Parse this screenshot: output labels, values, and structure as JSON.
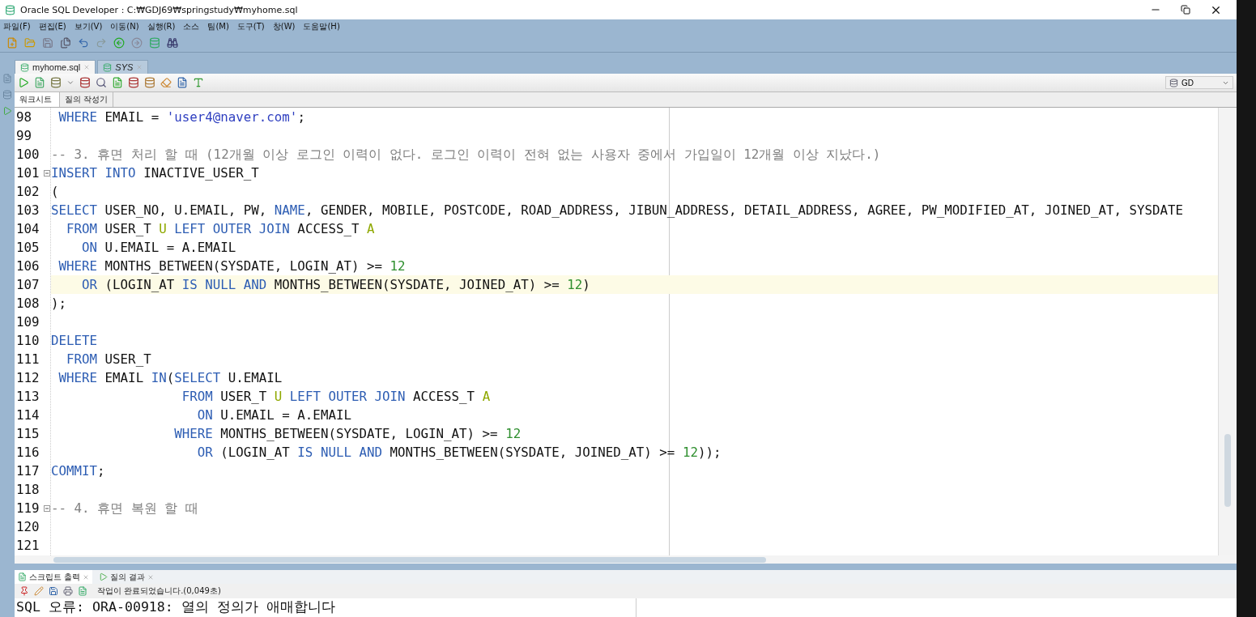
{
  "window": {
    "title": "Oracle SQL Developer : C:₩GDJ69₩springstudy₩myhome.sql"
  },
  "menu": [
    "파일(F)",
    "편집(E)",
    "보기(V)",
    "이동(N)",
    "실행(R)",
    "소스",
    "팀(M)",
    "도구(T)",
    "창(W)",
    "도움말(H)"
  ],
  "editor_tabs": [
    {
      "label": "myhome.sql",
      "selected": true
    },
    {
      "label": "SYS",
      "selected": false
    }
  ],
  "connection": "GD",
  "sub_tabs": [
    {
      "label": "워크시트",
      "selected": true
    },
    {
      "label": "질의 작성기",
      "selected": false
    }
  ],
  "code_lines": [
    {
      "number": "98",
      "fold": false,
      "current": false,
      "tokens": [
        {
          "kind": "keyword",
          "text": " WHERE"
        },
        {
          "kind": "plain",
          "text": " EMAIL = "
        },
        {
          "kind": "string",
          "text": "'user4@naver.com'"
        },
        {
          "kind": "plain",
          "text": ";"
        }
      ]
    },
    {
      "number": "99",
      "fold": false,
      "current": false
    },
    {
      "number": "100",
      "fold": false,
      "current": false,
      "tokens": [
        {
          "kind": "comment",
          "text": "-- 3. 휴면 처리 할 때 (12개월 이상 로그인 이력이 없다. 로그인 이력이 전혀 없는 사용자 중에서 가입일이 12개월 이상 지났다.)"
        }
      ]
    },
    {
      "number": "101",
      "fold": true,
      "current": false,
      "tokens": [
        {
          "kind": "keyword",
          "text": "INSERT INTO"
        },
        {
          "kind": "plain",
          "text": " INACTIVE_USER_T"
        }
      ]
    },
    {
      "number": "102",
      "fold": false,
      "current": false,
      "tokens": [
        {
          "kind": "plain",
          "text": "("
        }
      ]
    },
    {
      "number": "103",
      "fold": false,
      "current": false,
      "tokens": [
        {
          "kind": "keyword",
          "text": "SELECT"
        },
        {
          "kind": "plain",
          "text": " USER_NO, U.EMAIL, PW, "
        },
        {
          "kind": "keyword",
          "text": "NAME"
        },
        {
          "kind": "plain",
          "text": ", GENDER, MOBILE, POSTCODE, ROAD_ADDRESS, JIBUN_ADDRESS, DETAIL_ADDRESS, AGREE, PW_MODIFIED_AT, JOINED_AT, SYSDATE"
        }
      ]
    },
    {
      "number": "104",
      "fold": false,
      "current": false,
      "tokens": [
        {
          "kind": "keyword",
          "text": "  FROM"
        },
        {
          "kind": "plain",
          "text": " USER_T"
        },
        {
          "kind": "alias",
          "text": " U"
        },
        {
          "kind": "keyword",
          "text": " LEFT OUTER JOIN"
        },
        {
          "kind": "plain",
          "text": " ACCESS_T"
        },
        {
          "kind": "alias",
          "text": " A"
        }
      ]
    },
    {
      "number": "105",
      "fold": false,
      "current": false,
      "tokens": [
        {
          "kind": "keyword",
          "text": "    ON"
        },
        {
          "kind": "plain",
          "text": " U.EMAIL = A.EMAIL"
        }
      ]
    },
    {
      "number": "106",
      "fold": false,
      "current": false,
      "tokens": [
        {
          "kind": "keyword",
          "text": " WHERE"
        },
        {
          "kind": "plain",
          "text": " MONTHS_BETWEEN(SYSDATE, LOGIN_AT) >= "
        },
        {
          "kind": "number",
          "text": "12"
        }
      ]
    },
    {
      "number": "107",
      "fold": false,
      "current": true,
      "tokens": [
        {
          "kind": "keyword",
          "text": "    OR"
        },
        {
          "kind": "plain",
          "text": " (LOGIN_AT"
        },
        {
          "kind": "keyword",
          "text": " IS NULL AND"
        },
        {
          "kind": "plain",
          "text": " MONTHS_BETWEEN(SYSDATE, JOINED_AT) >= "
        },
        {
          "kind": "number",
          "text": "12"
        },
        {
          "kind": "plain",
          "text": ")"
        }
      ]
    },
    {
      "number": "108",
      "fold": false,
      "current": false,
      "tokens": [
        {
          "kind": "plain",
          "text": ");"
        }
      ]
    },
    {
      "number": "109",
      "fold": false,
      "current": false
    },
    {
      "number": "110",
      "fold": false,
      "current": false,
      "tokens": [
        {
          "kind": "keyword",
          "text": "DELETE"
        }
      ]
    },
    {
      "number": "111",
      "fold": false,
      "current": false,
      "tokens": [
        {
          "kind": "keyword",
          "text": "  FROM"
        },
        {
          "kind": "plain",
          "text": " USER_T"
        }
      ]
    },
    {
      "number": "112",
      "fold": false,
      "current": false,
      "tokens": [
        {
          "kind": "keyword",
          "text": " WHERE"
        },
        {
          "kind": "plain",
          "text": " EMAIL"
        },
        {
          "kind": "keyword",
          "text": " IN"
        },
        {
          "kind": "plain",
          "text": "("
        },
        {
          "kind": "keyword",
          "text": "SELECT"
        },
        {
          "kind": "plain",
          "text": " U.EMAIL"
        }
      ]
    },
    {
      "number": "113",
      "fold": false,
      "current": false,
      "tokens": [
        {
          "kind": "keyword",
          "text": "                 FROM"
        },
        {
          "kind": "plain",
          "text": " USER_T"
        },
        {
          "kind": "alias",
          "text": " U"
        },
        {
          "kind": "keyword",
          "text": " LEFT OUTER JOIN"
        },
        {
          "kind": "plain",
          "text": " ACCESS_T"
        },
        {
          "kind": "alias",
          "text": " A"
        }
      ]
    },
    {
      "number": "114",
      "fold": false,
      "current": false,
      "tokens": [
        {
          "kind": "keyword",
          "text": "                   ON"
        },
        {
          "kind": "plain",
          "text": " U.EMAIL = A.EMAIL"
        }
      ]
    },
    {
      "number": "115",
      "fold": false,
      "current": false,
      "tokens": [
        {
          "kind": "keyword",
          "text": "                WHERE"
        },
        {
          "kind": "plain",
          "text": " MONTHS_BETWEEN(SYSDATE, LOGIN_AT) >= "
        },
        {
          "kind": "number",
          "text": "12"
        }
      ]
    },
    {
      "number": "116",
      "fold": false,
      "current": false,
      "tokens": [
        {
          "kind": "keyword",
          "text": "                   OR"
        },
        {
          "kind": "plain",
          "text": " (LOGIN_AT"
        },
        {
          "kind": "keyword",
          "text": " IS NULL AND"
        },
        {
          "kind": "plain",
          "text": " MONTHS_BETWEEN(SYSDATE, JOINED_AT) >= "
        },
        {
          "kind": "number",
          "text": "12"
        },
        {
          "kind": "plain",
          "text": "));"
        }
      ]
    },
    {
      "number": "117",
      "fold": false,
      "current": false,
      "tokens": [
        {
          "kind": "keyword",
          "text": "COMMIT"
        },
        {
          "kind": "plain",
          "text": ";"
        }
      ]
    },
    {
      "number": "118",
      "fold": false,
      "current": false
    },
    {
      "number": "119",
      "fold": true,
      "current": false,
      "tokens": [
        {
          "kind": "comment",
          "text": "-- 4. 휴면 복원 할 때"
        }
      ]
    },
    {
      "number": "120",
      "fold": false,
      "current": false
    },
    {
      "number": "121",
      "fold": false,
      "current": false
    }
  ],
  "output_tabs": [
    {
      "label": "스크립트 출력",
      "selected": true
    },
    {
      "label": "질의 결과",
      "selected": false
    }
  ],
  "output_status": "작업이 완료되었습니다.(0,049초)",
  "output_text": "SQL 오류: ORA-00918: 열의 정의가 애매합니다"
}
